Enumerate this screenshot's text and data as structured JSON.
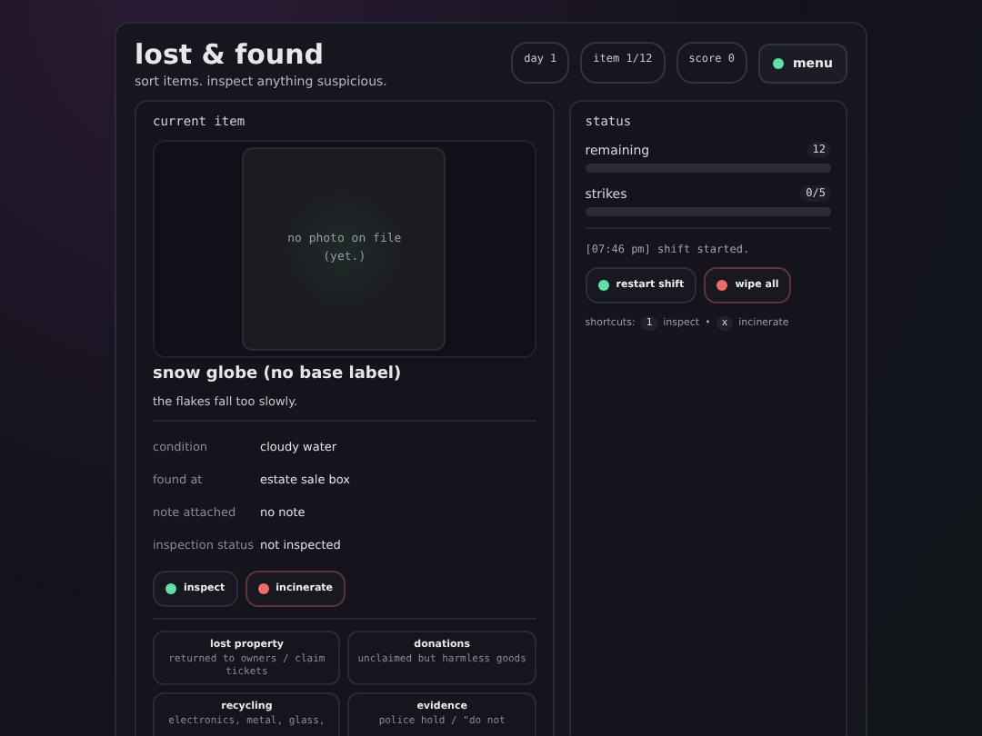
{
  "header": {
    "title": "lost & found",
    "subtitle": "sort items. inspect anything suspicious.",
    "chips": [
      "day 1",
      "item 1/12",
      "score 0"
    ],
    "menu": "menu"
  },
  "item": {
    "heading": "current item",
    "photo_text": [
      "no photo on file",
      "(yet.)"
    ],
    "name": "snow globe (no base label)",
    "description": "the flakes fall too slowly.",
    "fields": [
      {
        "label": "condition",
        "value": "cloudy water"
      },
      {
        "label": "found at",
        "value": "estate sale box"
      },
      {
        "label": "note attached",
        "value": "no note"
      },
      {
        "label": "inspection status",
        "value": "not inspected"
      }
    ],
    "actions": [
      {
        "label": "inspect",
        "color": "#5ee0a8"
      },
      {
        "label": "incinerate",
        "color": "#f06a6a"
      }
    ],
    "bins": [
      {
        "title": "lost property",
        "text": "returned to owners / claim tickets"
      },
      {
        "title": "donations",
        "text": "unclaimed but harmless goods"
      },
      {
        "title": "recycling",
        "text": "electronics, metal, glass,"
      },
      {
        "title": "evidence",
        "text": "police hold / \"do not"
      }
    ]
  },
  "status": {
    "heading": "status",
    "meters": [
      {
        "label": "remaining",
        "reading": "12",
        "level": 0
      },
      {
        "label": "strikes",
        "reading": "0/5",
        "level": 0
      }
    ],
    "log": "[07:46 pm] shift started.",
    "buttons": [
      {
        "label": "restart shift",
        "color": "#5ee0a8"
      },
      {
        "label": "wipe all",
        "color": "#f06a6a"
      }
    ],
    "shortcuts": {
      "label": "shortcuts:",
      "keys": [
        {
          "key": "1",
          "action": "inspect"
        },
        {
          "key": "x",
          "action": "incinerate"
        }
      ],
      "separator": "•"
    }
  }
}
